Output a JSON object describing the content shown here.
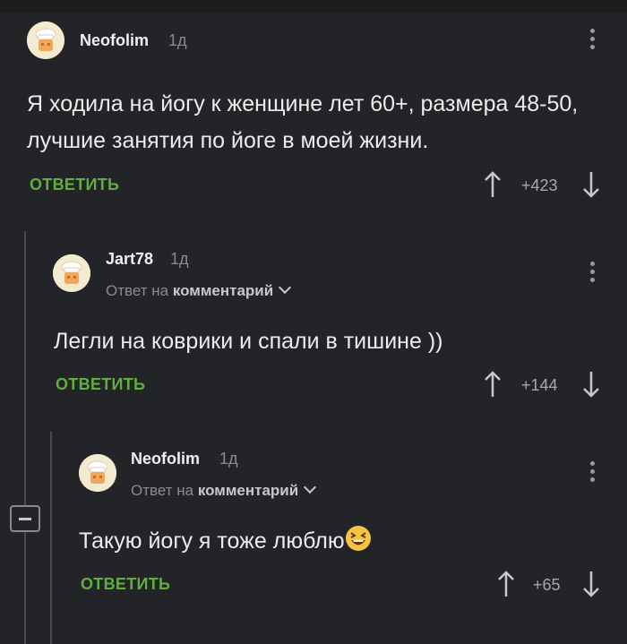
{
  "comments": [
    {
      "username": "Neofolim",
      "time": "1д",
      "text": "Я ходила на йогу к женщине лет 60+, размера 48-50, лучшие занятия по йоге в моей жизни.",
      "reply_label": "ОТВЕТИТЬ",
      "rating": "+423"
    },
    {
      "username": "Jart78",
      "time": "1д",
      "reply_prefix": "Ответ на",
      "reply_target": "комментарий",
      "text": "Легли на коврики и спали в тишине ))",
      "reply_label": "ОТВЕТИТЬ",
      "rating": "+144"
    },
    {
      "username": "Neofolim",
      "time": "1д",
      "reply_prefix": "Ответ на",
      "reply_target": "комментарий",
      "text": "Такую йогу я тоже люблю",
      "emoji": "laughing-face",
      "reply_label": "ОТВЕТИТЬ",
      "rating": "+65"
    }
  ],
  "colors": {
    "background": "#232427",
    "accent_green": "#5fae3e",
    "muted": "#8a8b8f"
  }
}
